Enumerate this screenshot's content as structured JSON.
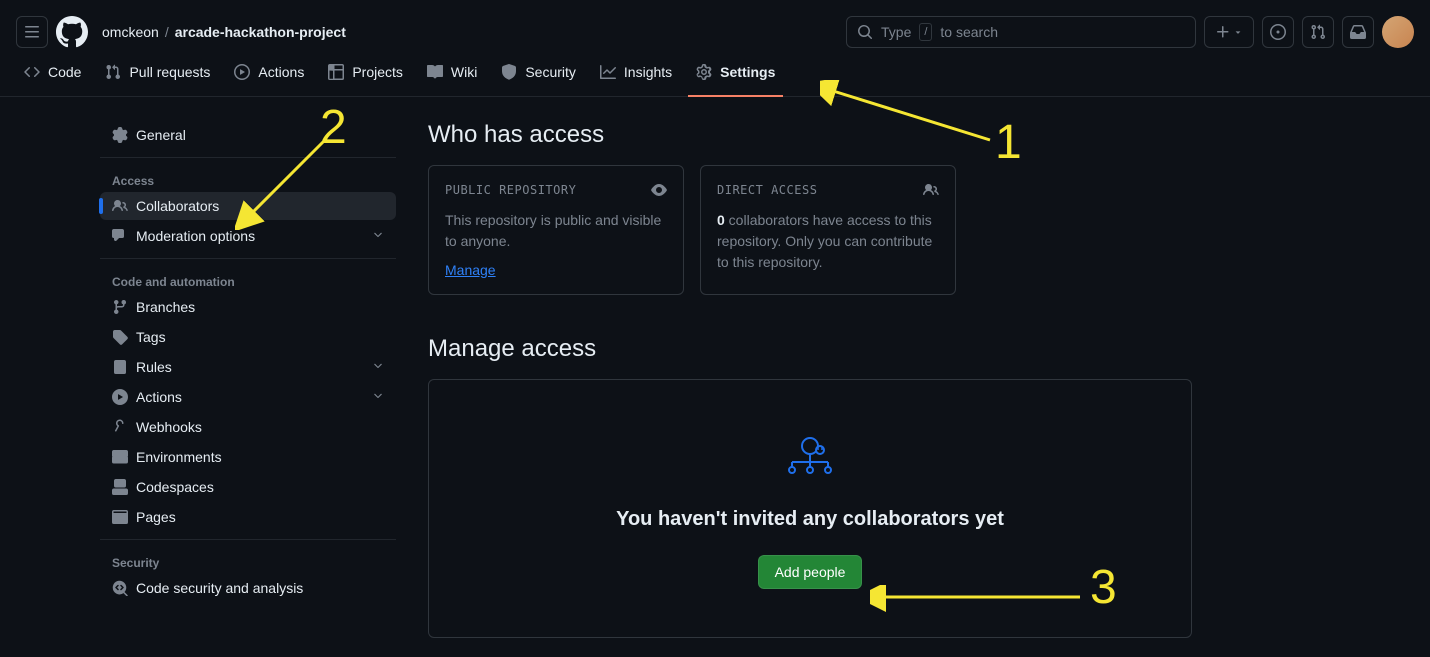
{
  "header": {
    "owner": "omckeon",
    "repo": "arcade-hackathon-project",
    "search_prefix": "Type",
    "search_kbd": "/",
    "search_suffix": "to search"
  },
  "tabs": {
    "code": "Code",
    "pulls": "Pull requests",
    "actions": "Actions",
    "projects": "Projects",
    "wiki": "Wiki",
    "security": "Security",
    "insights": "Insights",
    "settings": "Settings"
  },
  "sidebar": {
    "general": "General",
    "section_access": "Access",
    "collaborators": "Collaborators",
    "moderation": "Moderation options",
    "section_code": "Code and automation",
    "branches": "Branches",
    "tags": "Tags",
    "rules": "Rules",
    "actions": "Actions",
    "webhooks": "Webhooks",
    "environments": "Environments",
    "codespaces": "Codespaces",
    "pages": "Pages",
    "section_security": "Security",
    "code_security": "Code security and analysis"
  },
  "access": {
    "heading": "Who has access",
    "public_label": "PUBLIC REPOSITORY",
    "public_text": "This repository is public and visible to anyone.",
    "manage_link": "Manage",
    "direct_label": "DIRECT ACCESS",
    "direct_count": "0",
    "direct_text": " collaborators have access to this repository. Only you can contribute to this repository."
  },
  "manage": {
    "heading": "Manage access",
    "empty": "You haven't invited any collaborators yet",
    "add": "Add people"
  },
  "annotations": {
    "n1": "1",
    "n2": "2",
    "n3": "3"
  }
}
